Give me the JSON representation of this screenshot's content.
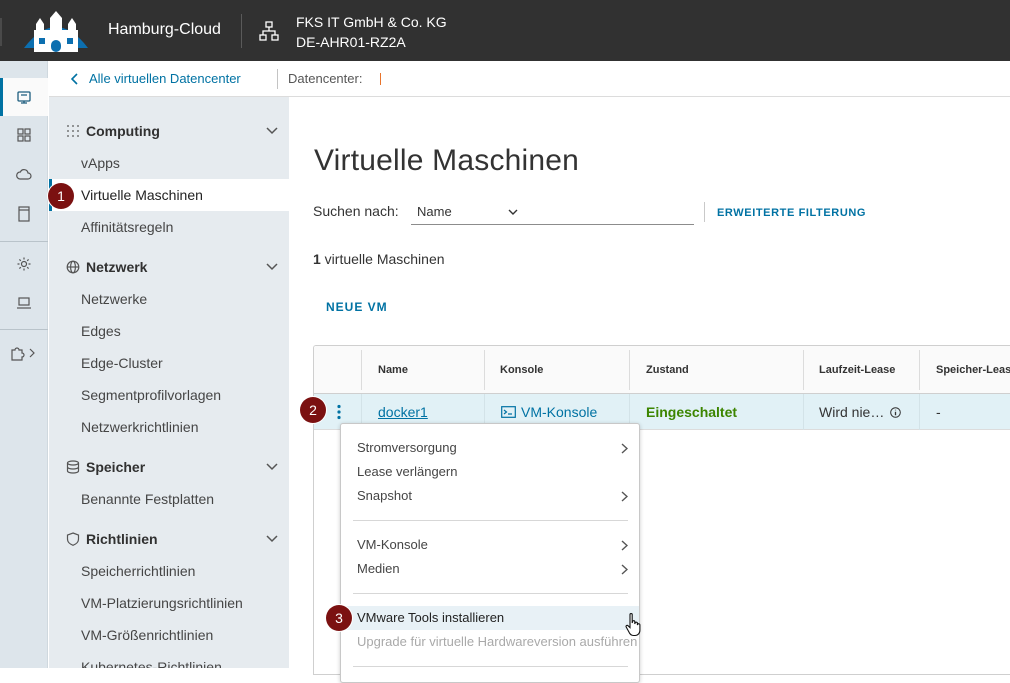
{
  "header": {
    "app_title": "Hamburg-Cloud",
    "org_name": "FKS IT GmbH & Co. KG",
    "org_site": "DE-AHR01-RZ2A",
    "bg_color": "#313131"
  },
  "rail": {
    "items": [
      {
        "icon": "vm-server-icon",
        "active": true
      },
      {
        "icon": "grid-apps-icon"
      },
      {
        "icon": "cloud-icon"
      },
      {
        "icon": "library-book-icon"
      },
      {
        "icon": "gear-icon"
      },
      {
        "icon": "laptop-icon"
      },
      {
        "icon": "puzzle-extensions-icon"
      }
    ]
  },
  "breadcrumb": {
    "back_label": "Alle virtuellen Datencenter",
    "datacenter_label": "Datencenter:"
  },
  "sidebar": {
    "groups": [
      {
        "label": "Computing",
        "icon": "grid-dots-icon",
        "items": [
          "vApps",
          "Virtuelle Maschinen",
          "Affinitätsregeln"
        ]
      },
      {
        "label": "Netzwerk",
        "icon": "globe-icon",
        "items": [
          "Netzwerke",
          "Edges",
          "Edge-Cluster",
          "Segmentprofilvorlagen",
          "Netzwerkrichtlinien"
        ]
      },
      {
        "label": "Speicher",
        "icon": "database-icon",
        "items": [
          "Benannte Festplatten"
        ]
      },
      {
        "label": "Richtlinien",
        "icon": "shield-icon",
        "items": [
          "Speicherrichtlinien",
          "VM-Platzierungsrichtlinien",
          "VM-Größenrichtlinien",
          "Kubernetes-Richtlinien"
        ]
      }
    ],
    "active_item": "Virtuelle Maschinen"
  },
  "main": {
    "title": "Virtuelle Maschinen",
    "search_label": "Suchen nach:",
    "search_field": "Name",
    "advanced_filter": "ERWEITERTE FILTERUNG",
    "count_number": "1",
    "count_suffix": " virtuelle Maschinen",
    "new_vm": "NEUE VM"
  },
  "grid": {
    "columns": [
      "Name",
      "Konsole",
      "Zustand",
      "Laufzeit-Lease",
      "Speicher-Lease"
    ],
    "rows": [
      {
        "name": "docker1",
        "console": "VM-Konsole",
        "state": "Eingeschaltet",
        "runtime_lease": "Wird nie…",
        "storage_lease": "-"
      }
    ]
  },
  "context_menu": {
    "items": [
      {
        "label": "Stromversorgung",
        "submenu": true
      },
      {
        "label": "Lease verlängern",
        "submenu": false
      },
      {
        "label": "Snapshot",
        "submenu": true
      },
      {
        "label": "VM-Konsole",
        "submenu": true
      },
      {
        "label": "Medien",
        "submenu": true
      },
      {
        "label": "VMware Tools installieren",
        "submenu": false,
        "hovered": true
      },
      {
        "label": "Upgrade für virtuelle Hardwareversion ausführen",
        "submenu": false,
        "disabled": true
      }
    ]
  },
  "markers": [
    "1",
    "2",
    "3"
  ],
  "colors": {
    "accent": "#0072a3",
    "state_on": "#3c8500",
    "marker": "#7b1111",
    "sidebar_bg": "#e6ebef"
  }
}
